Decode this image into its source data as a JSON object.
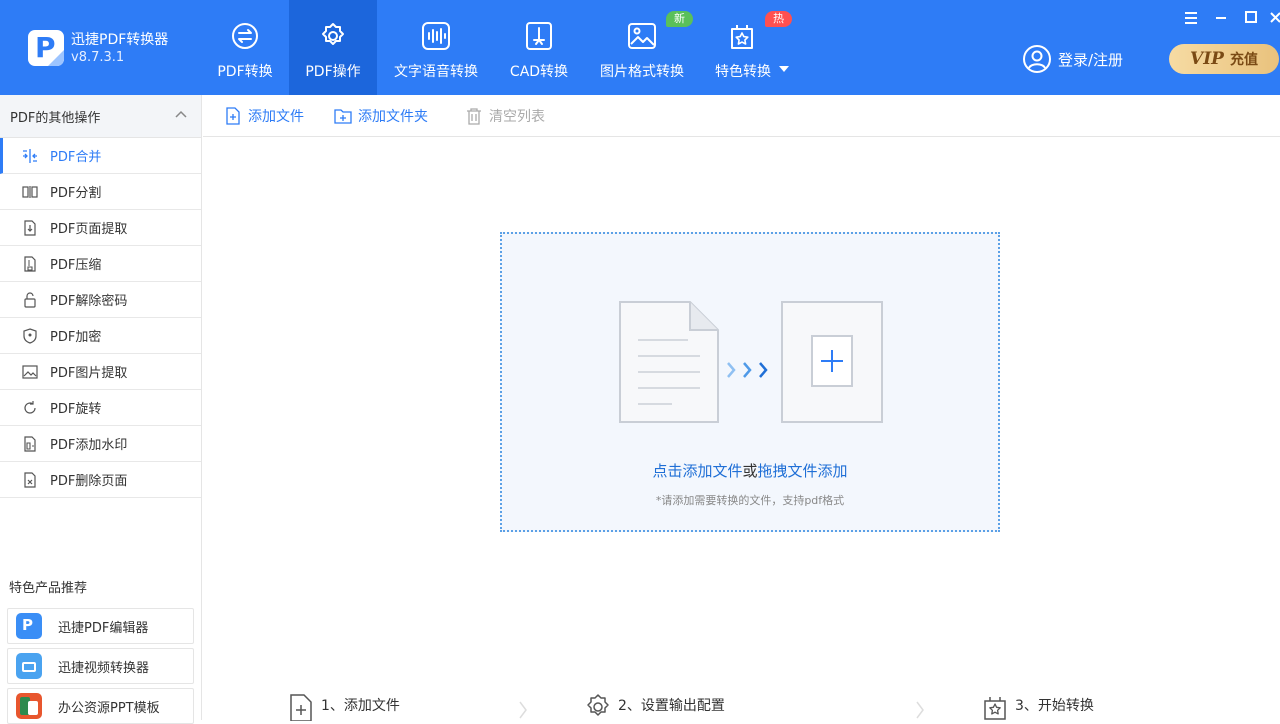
{
  "app": {
    "name": "迅捷PDF转换器",
    "version": "v8.7.3.1"
  },
  "nav": [
    {
      "label": "PDF转换",
      "icon": "convert-icon",
      "active": false
    },
    {
      "label": "PDF操作",
      "icon": "gear-icon",
      "active": true
    },
    {
      "label": "文字语音转换",
      "icon": "audio-wave-icon",
      "active": false
    },
    {
      "label": "CAD转换",
      "icon": "cad-icon",
      "active": false
    },
    {
      "label": "图片格式转换",
      "icon": "image-icon",
      "active": false,
      "badge": "新"
    },
    {
      "label": "特色转换",
      "icon": "star-box-icon",
      "active": false,
      "badge": "热"
    }
  ],
  "header": {
    "login_label": "登录/注册",
    "vip_text": "VIP",
    "vip_action": "充值"
  },
  "sidebar": {
    "section_title": "PDF的其他操作",
    "items": [
      {
        "label": "PDF合并",
        "icon": "merge-icon",
        "active": true
      },
      {
        "label": "PDF分割",
        "icon": "split-icon"
      },
      {
        "label": "PDF页面提取",
        "icon": "page-extract-icon"
      },
      {
        "label": "PDF压缩",
        "icon": "compress-icon"
      },
      {
        "label": "PDF解除密码",
        "icon": "unlock-icon"
      },
      {
        "label": "PDF加密",
        "icon": "shield-icon"
      },
      {
        "label": "PDF图片提取",
        "icon": "image-extract-icon"
      },
      {
        "label": "PDF旋转",
        "icon": "rotate-icon"
      },
      {
        "label": "PDF添加水印",
        "icon": "watermark-icon"
      },
      {
        "label": "PDF删除页面",
        "icon": "delete-page-icon"
      }
    ],
    "recommend_title": "特色产品推荐",
    "recommend": [
      {
        "label": "迅捷PDF编辑器",
        "icon": "pdf-editor-app-icon",
        "color": "#3a8ef6"
      },
      {
        "label": "迅捷视频转换器",
        "icon": "video-converter-app-icon",
        "color": "#4aa3f0"
      },
      {
        "label": "办公资源PPT模板",
        "icon": "ppt-template-app-icon",
        "color": "#e8562e"
      }
    ]
  },
  "toolbar": {
    "add_file": "添加文件",
    "add_folder": "添加文件夹",
    "clear_list": "清空列表"
  },
  "dropzone": {
    "link_click": "点击添加文件",
    "link_or": "或",
    "link_drag": "拖拽文件添加",
    "hint": "*请添加需要转换的文件，支持pdf格式"
  },
  "steps": [
    {
      "title": "1、添加文件",
      "icon": "add-file-step-icon"
    },
    {
      "title": "2、设置输出配置",
      "icon": "settings-step-icon"
    },
    {
      "title": "3、开始转换",
      "icon": "start-convert-step-icon"
    }
  ],
  "colors": {
    "primary": "#2e7cf6",
    "active_nav": "#1c66dc",
    "badge_new": "#5ac05a",
    "badge_hot": "#ff5050",
    "vip_gold": "#e9c27d"
  }
}
